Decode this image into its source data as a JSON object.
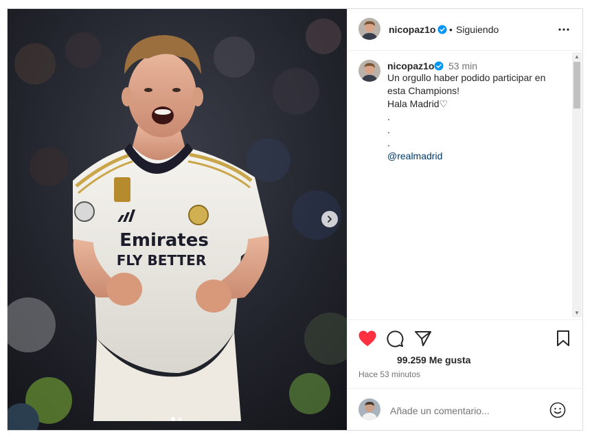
{
  "post": {
    "author": "nicopaz1o",
    "follow_separator": "•",
    "follow_status": "Siguiendo",
    "caption_time": "53 min",
    "caption_lines": [
      "Un orgullo haber podido participar en",
      "esta Champions!",
      "Hala Madrid♡",
      ".",
      ".",
      "."
    ],
    "mention": "@realmadrid",
    "likes": "99.259 Me gusta",
    "posted_ago": "Hace 53 minutos",
    "comment_placeholder": "Añade un comentario...",
    "photo": {
      "shirt_sponsor_line1": "Emirates",
      "shirt_sponsor_line2": "FLY BETTER",
      "carousel_index": 1,
      "carousel_count": 2
    }
  },
  "colors": {
    "like_red": "#ff3040",
    "verified_blue": "#0095f6",
    "mention_blue": "#00376b",
    "muted_gray": "#737373"
  },
  "icons": [
    "verified-badge-icon",
    "more-options-icon",
    "heart-icon",
    "comment-icon",
    "share-icon",
    "bookmark-icon",
    "emoji-icon",
    "chevron-right-icon"
  ]
}
